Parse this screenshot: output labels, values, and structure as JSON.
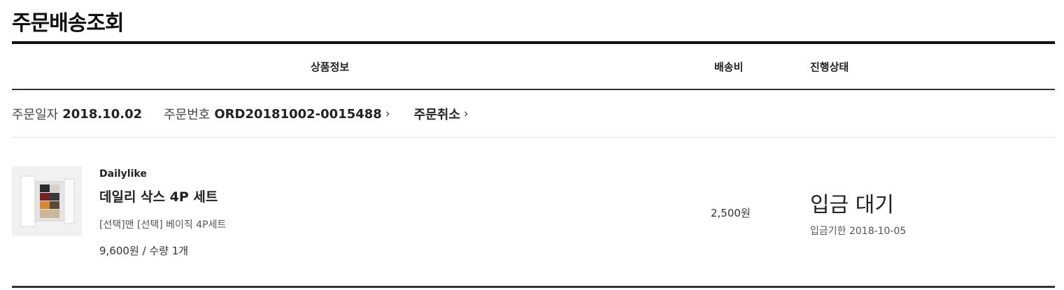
{
  "page": {
    "title": "주문배송조회"
  },
  "table_header": {
    "product_info": "상품정보",
    "shipping_fee": "배송비",
    "status": "진행상태"
  },
  "order": {
    "date_label": "주문일자",
    "date_value": "2018.10.02",
    "number_label": "주문번호",
    "number_value": "ORD20181002-0015488",
    "chevron": "›",
    "cancel_label": "주문취소"
  },
  "item": {
    "thumbnail_icon": "product-image-socks-box",
    "brand": "Dailylike",
    "name": "데일리 삭스 4P 세트",
    "option": "[선택]맨 [선택] 베이직 4P세트",
    "price_qty": "9,600원 / 수량 1개",
    "shipping_fee": "2,500원",
    "status": "입금 대기",
    "deadline": "입금기한 2018-10-05"
  }
}
